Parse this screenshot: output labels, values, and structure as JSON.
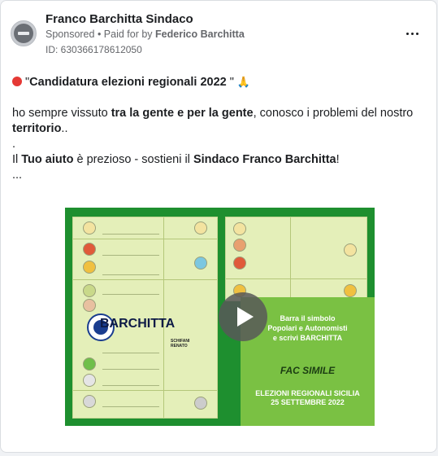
{
  "post": {
    "page_name": "Franco Barchitta Sindaco",
    "sponsored": "Sponsored",
    "paid_prefix": " • Paid for by ",
    "paid_by": "Federico Barchitta",
    "ad_id": "ID: 630366178612050",
    "more_icon": "more-dots-icon",
    "avatar_icon": "no-entry-icon"
  },
  "text": {
    "l1_quote_open": "\"",
    "l1_title": "Candidatura elezioni regionali 2022",
    "l1_quote_close": " \" ",
    "l2_a": "ho sempre vissuto ",
    "l2_bold": "tra la gente e per la gente",
    "l2_b": ", conosco i problemi del nostro",
    "l3_bold": "territorio",
    "l3_tail": "..",
    "l4": ".",
    "l5_a": "Il ",
    "l5_bold1": "Tuo aiuto",
    "l5_b": " è prezioso - sostieni il ",
    "l5_bold2": "Sindaco Franco Barchitta",
    "l5_c": "!",
    "l6": "..."
  },
  "media": {
    "candidate_name": "BARCHITTA",
    "other_candidate_1": "SCHIFANI",
    "other_candidate_2": "RENATO",
    "panel_l1": "Barra il simbolo",
    "panel_l2": "Popolari e Autonomisti",
    "panel_l3": "e scrivi BARCHITTA",
    "fac_simile": "FAC SIMILE",
    "election_l1": "ELEZIONI REGIONALI SICILIA",
    "election_l2": "25 SETTEMBRE 2022",
    "play_icon": "play-icon"
  },
  "colors": {
    "frame_green": "#1e8f2f",
    "panel_green": "#7ac143",
    "ballot_bg": "#e4efb9"
  }
}
